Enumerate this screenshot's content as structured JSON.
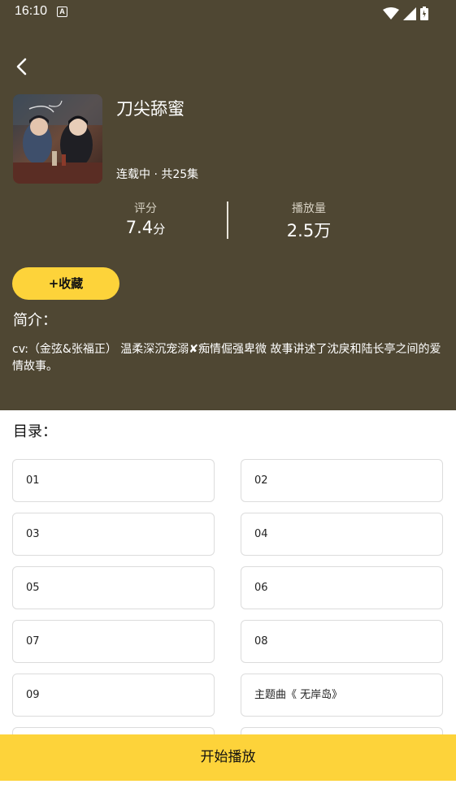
{
  "status_bar": {
    "time": "16:10",
    "notification_icon_letter": "A",
    "icons": [
      "wifi-icon",
      "cell-signal-icon",
      "battery-icon"
    ]
  },
  "album": {
    "title": "刀尖舔蜜",
    "meta": "连载中 · 共25集",
    "cover_icon": "album-cover-art"
  },
  "stats": {
    "rating_label": "评分",
    "rating_value": "7.4",
    "rating_unit": "分",
    "plays_label": "播放量",
    "plays_value": "2.5万"
  },
  "actions": {
    "collect_label": "+收藏",
    "play_label": "开始播放"
  },
  "intro": {
    "heading": "简介：",
    "text": "cv:（金弦&张福正） 温柔深沉宠溺✘痴情倔强卑微 故事讲述了沈戾和陆长亭之间的爱情故事。"
  },
  "catalog": {
    "heading": "目录：",
    "episodes": [
      "01",
      "02",
      "03",
      "04",
      "05",
      "06",
      "07",
      "08",
      "09",
      "主题曲《 无岸岛》"
    ]
  },
  "colors": {
    "header_bg": "#4f4733",
    "accent_yellow": "#fdd33a",
    "page_bg": "#ffffff"
  }
}
